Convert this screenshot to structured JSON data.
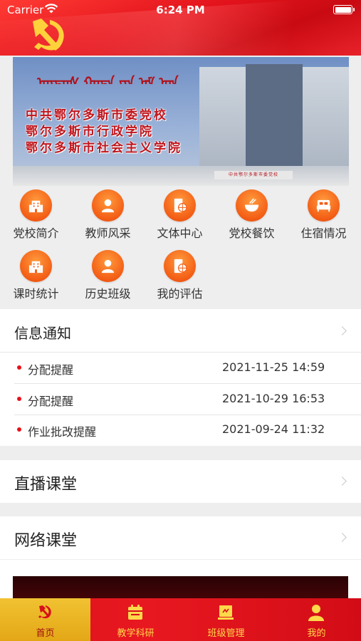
{
  "status_bar": {
    "carrier": "Carrier",
    "time": "6:24 PM"
  },
  "banner": {
    "mongolian_text": "ᠣᠷᠳᠣᠰ ᠬᠣᠲᠠ ᠶᠢᠨ ᠨᠠᠮ ᠤᠨ",
    "line1": "中共鄂尔多斯市委党校",
    "line2": "鄂尔多斯市行政学院",
    "line3": "鄂尔多斯市社会主义学院",
    "gate_sign": "中共鄂尔多斯市委党校"
  },
  "menu": [
    {
      "label": "党校简介",
      "icon": "building-icon"
    },
    {
      "label": "教师风采",
      "icon": "person-icon"
    },
    {
      "label": "文体中心",
      "icon": "sports-center-icon"
    },
    {
      "label": "党校餐饮",
      "icon": "bowl-icon"
    },
    {
      "label": "住宿情况",
      "icon": "bed-icon"
    },
    {
      "label": "课时统计",
      "icon": "building-icon"
    },
    {
      "label": "历史班级",
      "icon": "person-icon"
    },
    {
      "label": "我的评估",
      "icon": "sports-center-icon"
    }
  ],
  "info": {
    "title": "信息通知",
    "items": [
      {
        "title": "分配提醒",
        "date": "2021-11-25 14:59"
      },
      {
        "title": "分配提醒",
        "date": "2021-10-29 16:53"
      },
      {
        "title": "作业批改提醒",
        "date": "2021-09-24 11:32"
      }
    ]
  },
  "live": {
    "title": "直播课堂"
  },
  "online": {
    "title": "网络课堂"
  },
  "tabs": [
    {
      "label": "首页",
      "icon": "party-emblem-icon",
      "active": true
    },
    {
      "label": "教学科研",
      "icon": "calendar-icon",
      "active": false
    },
    {
      "label": "班级管理",
      "icon": "class-board-icon",
      "active": false
    },
    {
      "label": "我的",
      "icon": "user-icon",
      "active": false
    }
  ],
  "colors": {
    "primary_red": "#e3131c",
    "accent_orange": "#f35d15",
    "tab_active": "#f1c232"
  }
}
